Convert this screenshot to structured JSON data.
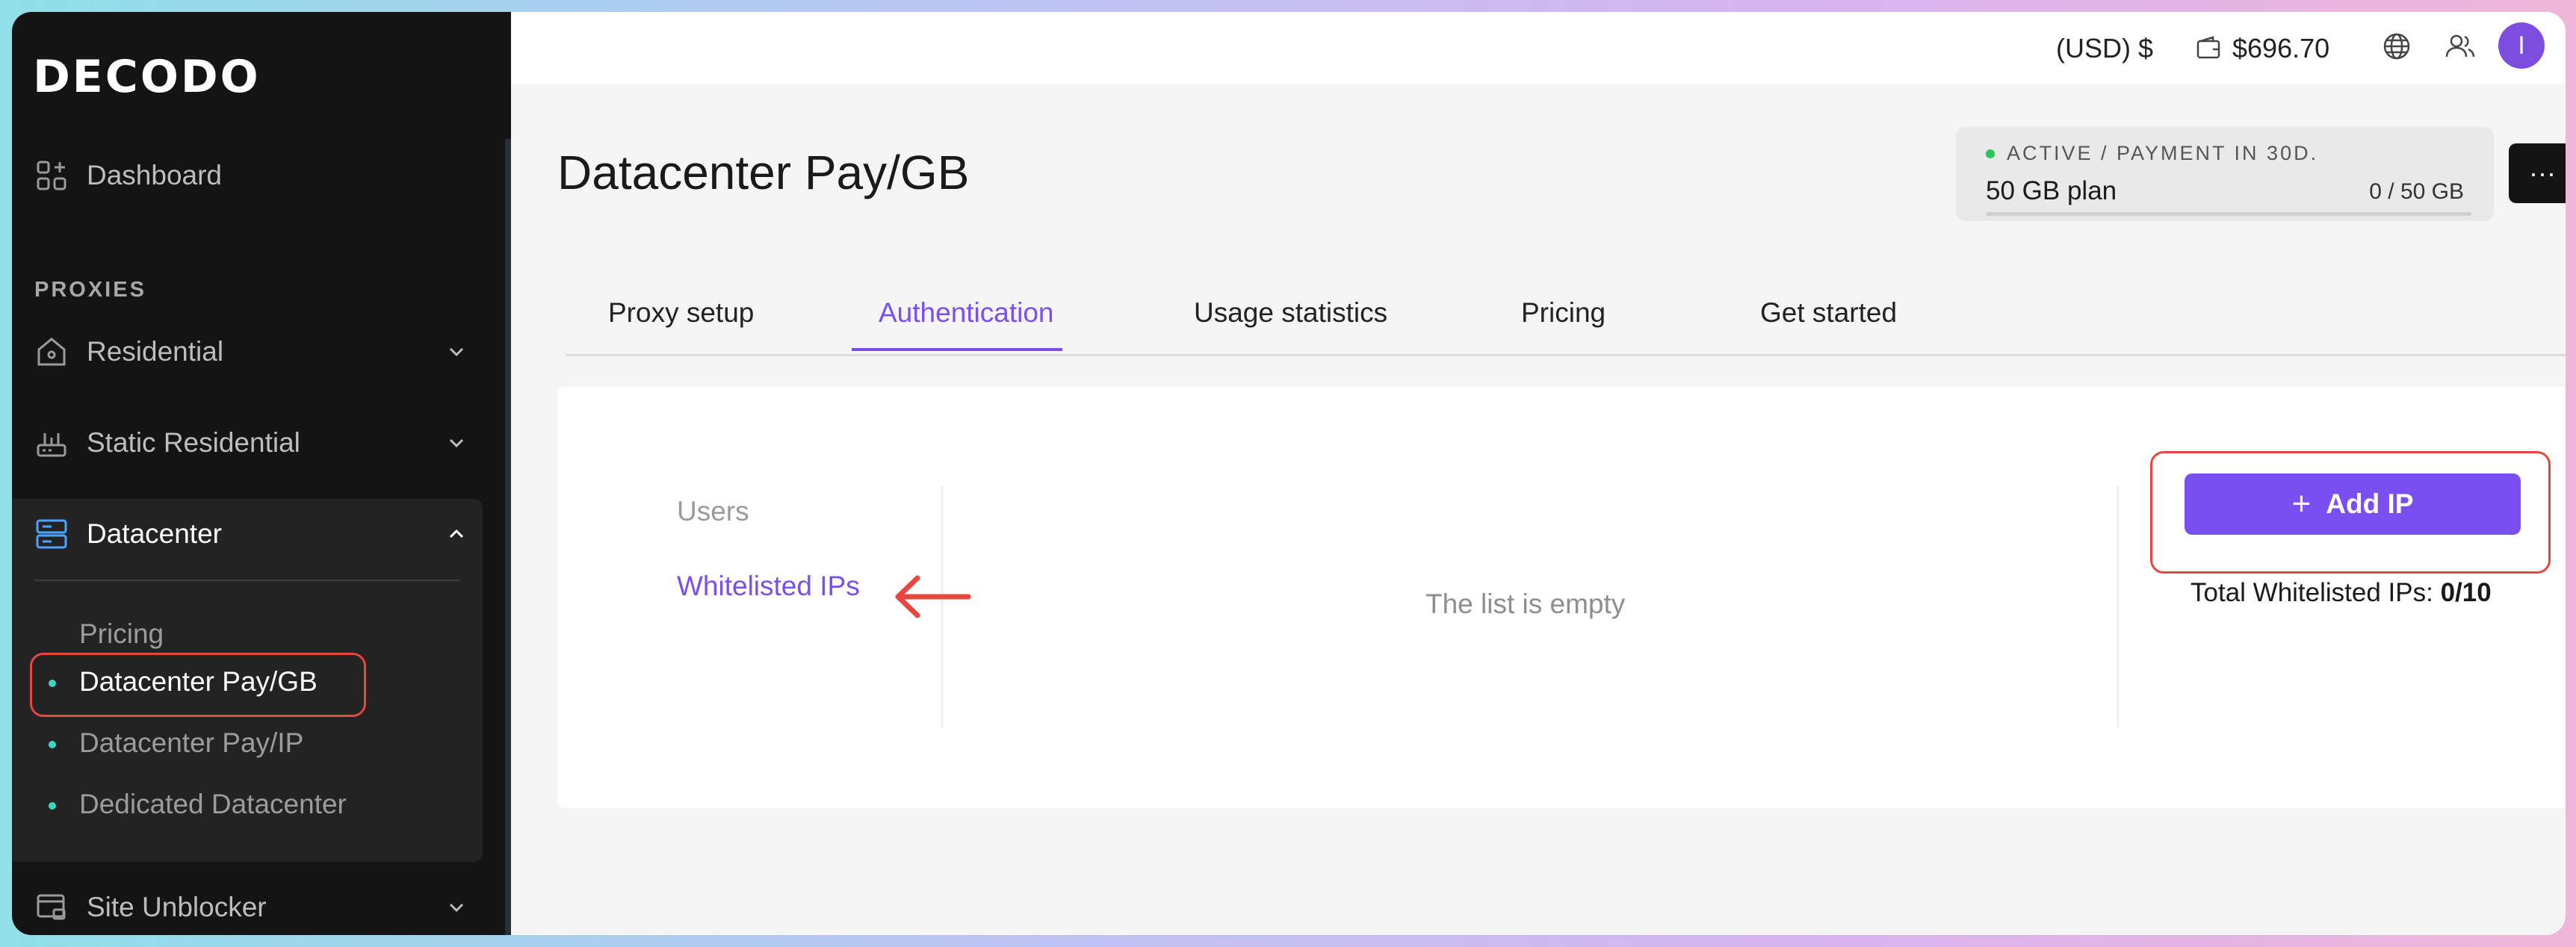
{
  "brand": {
    "logo_text": "DECODO"
  },
  "sidebar": {
    "dashboard": "Dashboard",
    "section_label": "PROXIES",
    "items": [
      {
        "label": "Residential"
      },
      {
        "label": "Static Residential"
      },
      {
        "label": "Datacenter"
      },
      {
        "label": "Site Unblocker"
      }
    ],
    "datacenter_sub": [
      "Pricing",
      "Datacenter Pay/GB",
      "Datacenter Pay/IP",
      "Dedicated Datacenter"
    ]
  },
  "topbar": {
    "currency": "(USD) $",
    "balance": "$696.70",
    "avatar_initial": "I"
  },
  "page": {
    "title": "Datacenter Pay/GB",
    "plan": {
      "status": "ACTIVE / PAYMENT IN 30D.",
      "name": "50 GB plan",
      "usage": "0 / 50 GB",
      "used_fraction": 0,
      "more_label": "···"
    },
    "tabs": [
      "Proxy setup",
      "Authentication",
      "Usage statistics",
      "Pricing",
      "Get started"
    ],
    "active_tab": "Authentication",
    "auth": {
      "links": [
        "Users",
        "Whitelisted IPs"
      ],
      "active_link": "Whitelisted IPs",
      "empty_text": "The list is empty",
      "add_button": "Add IP",
      "total_label": "Total Whitelisted IPs:",
      "total_value": "0/10"
    }
  },
  "colors": {
    "accent": "#7a4ff0",
    "highlight": "#e8473f",
    "sidebar_bg": "#141414",
    "status_green": "#2ec25b"
  }
}
